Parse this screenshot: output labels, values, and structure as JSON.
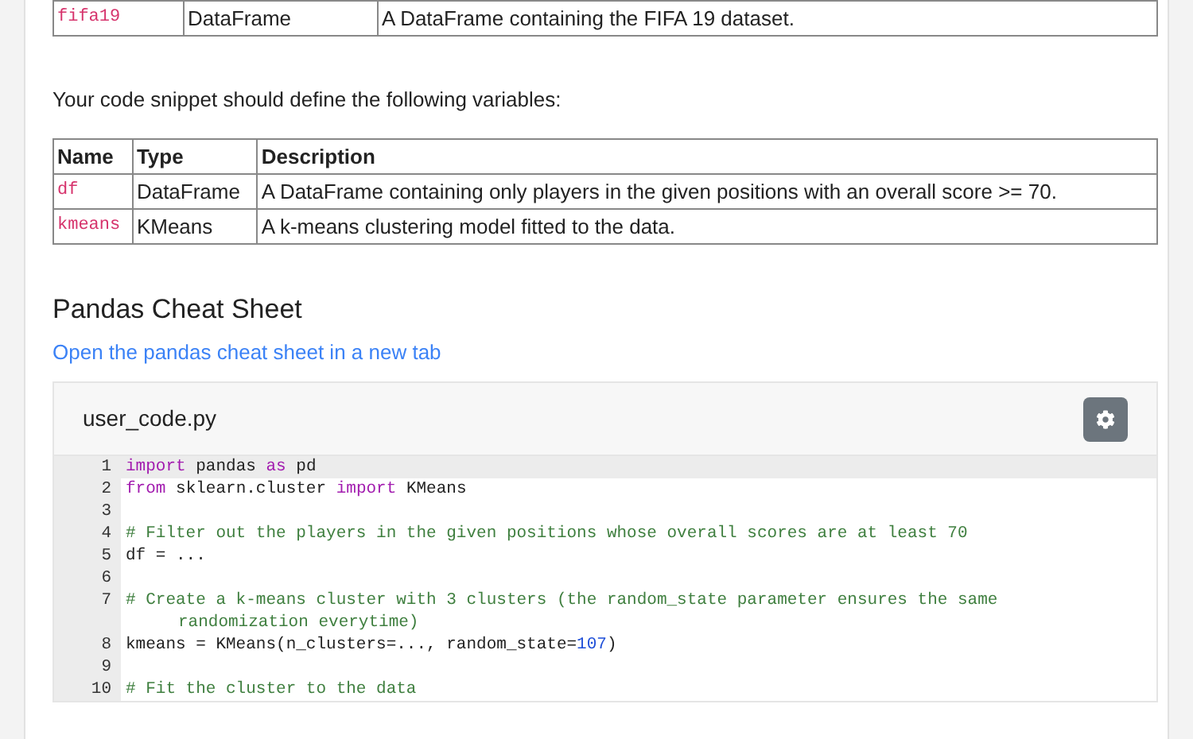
{
  "inputs_table": {
    "rows": [
      {
        "name": "fifa19",
        "type": "DataFrame",
        "description": "A DataFrame containing the FIFA 19 dataset."
      }
    ]
  },
  "outputs_intro": "Your code snippet should define the following variables:",
  "outputs_table": {
    "columns": [
      "Name",
      "Type",
      "Description"
    ],
    "rows": [
      {
        "name": "df",
        "type": "DataFrame",
        "description": "A DataFrame containing only players in the given positions with an overall score >= 70."
      },
      {
        "name": "kmeans",
        "type": "KMeans",
        "description": "A k-means clustering model fitted to the data."
      }
    ]
  },
  "cheat_sheet": {
    "heading": "Pandas Cheat Sheet",
    "link": "Open the pandas cheat sheet in a new tab"
  },
  "editor": {
    "filename": "user_code.py",
    "lines": [
      {
        "number": "1",
        "selected": true,
        "tokens": [
          {
            "kind": "keyword",
            "text": "import"
          },
          {
            "kind": "plain",
            "text": " pandas "
          },
          {
            "kind": "keyword",
            "text": "as"
          },
          {
            "kind": "plain",
            "text": " pd"
          }
        ]
      },
      {
        "number": "2",
        "selected": false,
        "tokens": [
          {
            "kind": "keyword",
            "text": "from"
          },
          {
            "kind": "plain",
            "text": " sklearn.cluster "
          },
          {
            "kind": "keyword",
            "text": "import"
          },
          {
            "kind": "plain",
            "text": " KMeans"
          }
        ]
      },
      {
        "number": "3",
        "selected": false
      },
      {
        "number": "4",
        "selected": false,
        "tokens": [
          {
            "kind": "comment",
            "text": "# Filter out the players in the given positions whose overall scores are at least 70"
          }
        ]
      },
      {
        "number": "5",
        "selected": false,
        "tokens": [
          {
            "kind": "plain",
            "text": "df = ..."
          }
        ]
      },
      {
        "number": "6",
        "selected": false
      },
      {
        "number": "7",
        "selected": false,
        "tokens": [
          {
            "kind": "comment",
            "text": "# Create a k-means cluster with 3 clusters (the random_state parameter ensures the same randomization everytime)"
          }
        ]
      },
      {
        "number": "8",
        "selected": false,
        "tokens": [
          {
            "kind": "plain",
            "text": "kmeans = KMeans(n_clusters=..., random_state="
          },
          {
            "kind": "number",
            "text": "107"
          },
          {
            "kind": "plain",
            "text": ")"
          }
        ]
      },
      {
        "number": "9",
        "selected": false
      },
      {
        "number": "10",
        "selected": false,
        "tokens": [
          {
            "kind": "comment",
            "text": "# Fit the cluster to the data"
          }
        ]
      }
    ]
  }
}
